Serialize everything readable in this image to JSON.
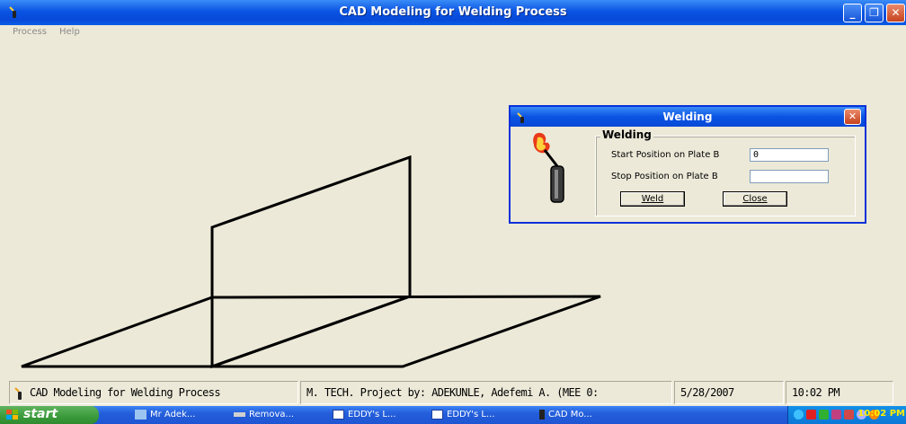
{
  "window": {
    "title": "CAD Modeling for Welding Process"
  },
  "menubar": {
    "items": [
      "Process",
      "Help"
    ]
  },
  "dialog": {
    "title": "Welding",
    "frame_label": "Welding",
    "start_label": "Start Position on Plate B",
    "start_value": "0",
    "stop_label": "Stop Position on Plate B",
    "stop_value": "",
    "weld_button": "Weld",
    "close_button": "Close"
  },
  "statusbar": {
    "app_name": "CAD Modeling for Welding Process",
    "project": "M. TECH. Project by: ADEKUNLE, Adefemi A. (MEE 0:",
    "date": "5/28/2007",
    "time": "10:02 PM"
  },
  "taskbar": {
    "start_label": "start",
    "tasks": [
      "Mr Adek...",
      "Remova...",
      "EDDY's L...",
      "EDDY's L...",
      "CAD Mo..."
    ],
    "clock": "10:02 PM"
  },
  "colors": {
    "titlebar_blue": "#0a54e3",
    "window_bg": "#ece9d8",
    "close_red": "#c6421e",
    "start_green": "#3a9a3a",
    "clock_yellow": "#ffee00"
  }
}
